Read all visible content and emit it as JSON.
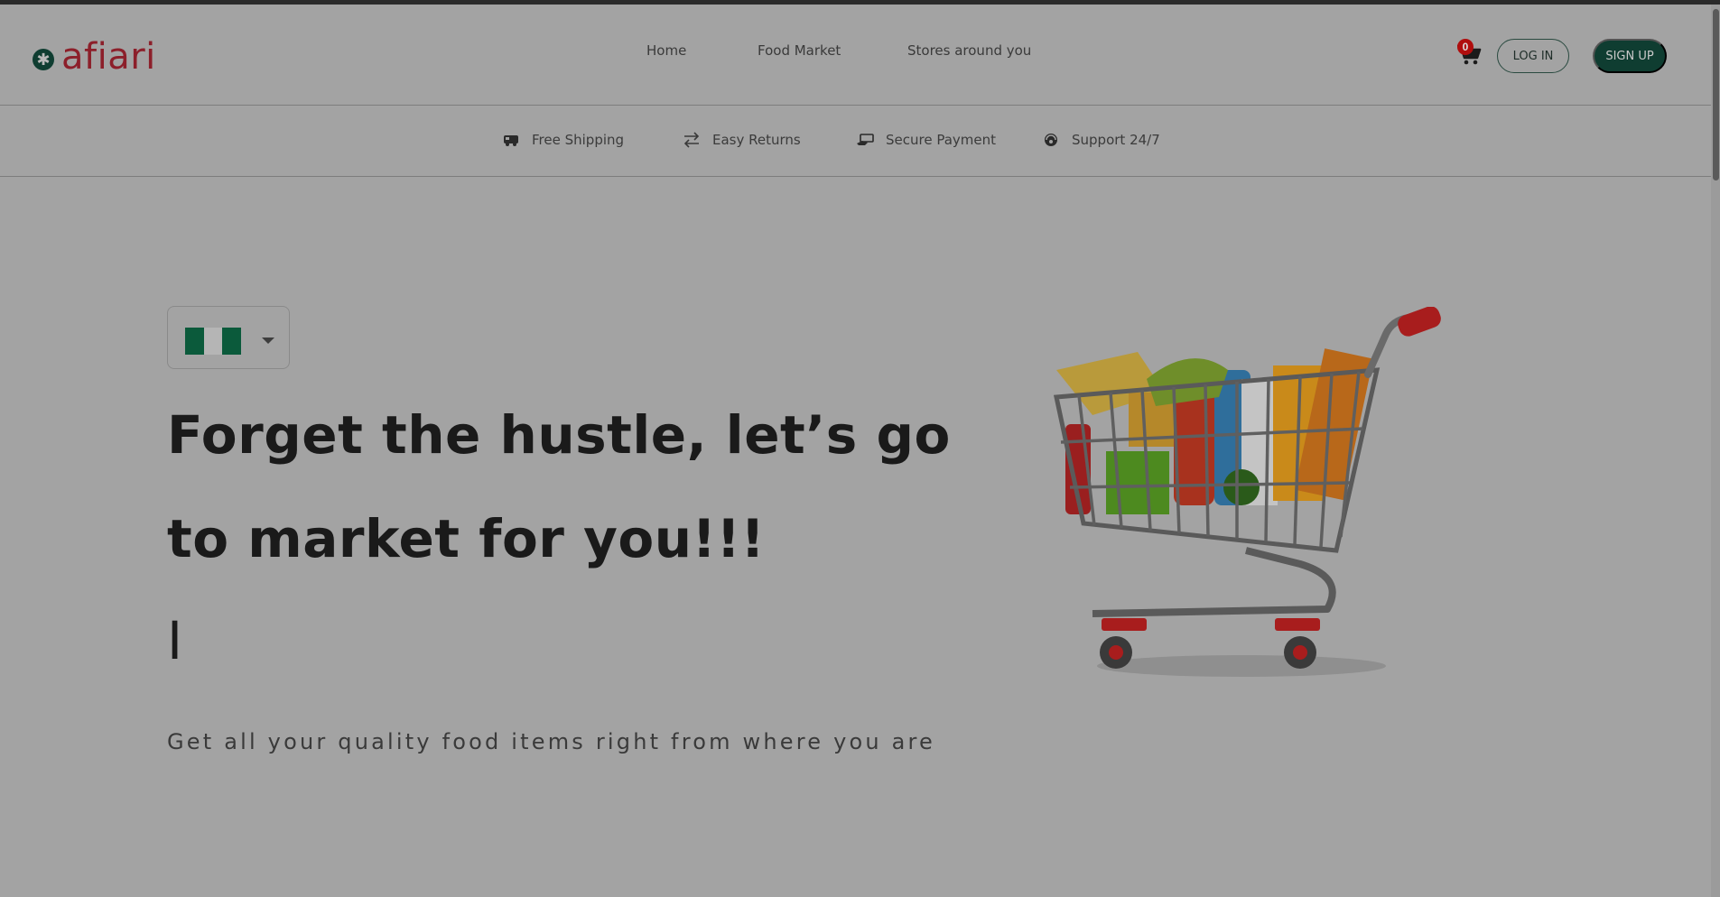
{
  "header": {
    "logo_text": "afiari",
    "logo_icon": "asterisk-badge-icon",
    "nav": [
      {
        "label": "Home"
      },
      {
        "label": "Food Market"
      },
      {
        "label": "Stores around you"
      }
    ],
    "cart": {
      "icon": "shopping-cart-icon",
      "count": "0"
    },
    "login_label": "LOG IN",
    "signup_label": "SIGN UP"
  },
  "features": [
    {
      "icon": "delivery-truck-icon",
      "label": "Free Shipping"
    },
    {
      "icon": "swap-arrows-icon",
      "label": "Easy Returns"
    },
    {
      "icon": "payment-hand-icon",
      "label": "Secure Payment"
    },
    {
      "icon": "headset-icon",
      "label": "Support 24/7"
    }
  ],
  "hero": {
    "country_flag": "nigeria-flag",
    "headline": "Forget the hustle, let’s go to market for you!!!",
    "typed_text": "I",
    "subline": "Get all your quality food items right from where you are",
    "image": "shopping-cart-with-groceries"
  },
  "colors": {
    "brand_green": "#0f3d31",
    "brand_red": "#8c1f2a",
    "badge_red": "#b00d0d",
    "flag_green": "#0b5a3b",
    "overlay_gray": "#a3a3a3"
  }
}
